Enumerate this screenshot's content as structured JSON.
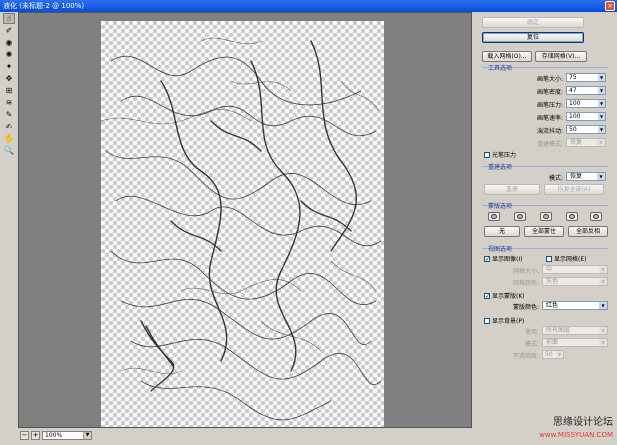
{
  "window": {
    "title": "液化 (未标题-2 @ 100%)",
    "close": "×"
  },
  "toolbar": {
    "tools": [
      {
        "icon": "forward-warp-icon",
        "glyph": "☝"
      },
      {
        "icon": "reconstruct-icon",
        "glyph": "✐"
      },
      {
        "icon": "twirl-icon",
        "glyph": "◉"
      },
      {
        "icon": "pucker-icon",
        "glyph": "✺"
      },
      {
        "icon": "bloat-icon",
        "glyph": "✦"
      },
      {
        "icon": "push-left-icon",
        "glyph": "✥"
      },
      {
        "icon": "mirror-icon",
        "glyph": "⊞"
      },
      {
        "icon": "turbulence-icon",
        "glyph": "≋"
      },
      {
        "icon": "freeze-mask-icon",
        "glyph": "✎"
      },
      {
        "icon": "thaw-mask-icon",
        "glyph": "✍"
      },
      {
        "icon": "hand-icon",
        "glyph": "✋"
      },
      {
        "icon": "zoom-icon",
        "glyph": "🔍"
      }
    ]
  },
  "bottom": {
    "minus": "−",
    "plus": "+",
    "zoom": "100%"
  },
  "panel": {
    "ok": "确定",
    "reset": "复位",
    "load_mesh": "载入网格(O)...",
    "save_mesh": "存储网格(V)...",
    "tool_options": {
      "title": "工具选项",
      "brush_size": {
        "label": "画笔大小:",
        "value": "75"
      },
      "brush_density": {
        "label": "画笔密度:",
        "value": "47"
      },
      "brush_pressure": {
        "label": "画笔压力:",
        "value": "100"
      },
      "brush_rate": {
        "label": "画笔速率:",
        "value": "100"
      },
      "turbulent_jitter": {
        "label": "湍流抖动:",
        "value": "50"
      },
      "reconstruct_mode": {
        "label": "重建模式:",
        "value": "恢复"
      },
      "stylus_pressure": "光笔压力"
    },
    "reconstruct_options": {
      "title": "重建选项",
      "mode_label": "模式:",
      "mode_value": "恢复",
      "reconstruct": "重建",
      "restore_all": "恢复全部(A)"
    },
    "mask_options": {
      "title": "蒙版选项",
      "none": "无",
      "mask_all": "全部蒙住",
      "invert_all": "全部反相"
    },
    "view_options": {
      "title": "视图选项",
      "show_image": "显示图像(I)",
      "show_mesh": "显示网格(E)",
      "mesh_size": {
        "label": "网格大小:",
        "value": "中"
      },
      "mesh_color": {
        "label": "网格颜色:",
        "value": "灰色"
      },
      "show_mask": "显示蒙版(K)",
      "mask_color": {
        "label": "蒙版颜色:",
        "value": "红色"
      },
      "show_backdrop": "显示背景(P)",
      "use": {
        "label": "使用:",
        "value": "所有图层"
      },
      "mode": {
        "label": "模式:",
        "value": "前面"
      },
      "opacity": {
        "label": "不透明度:",
        "value": "50"
      }
    }
  },
  "watermark": {
    "line1": "思缘设计论坛",
    "line2": "www.MISSYUAN.COM"
  }
}
